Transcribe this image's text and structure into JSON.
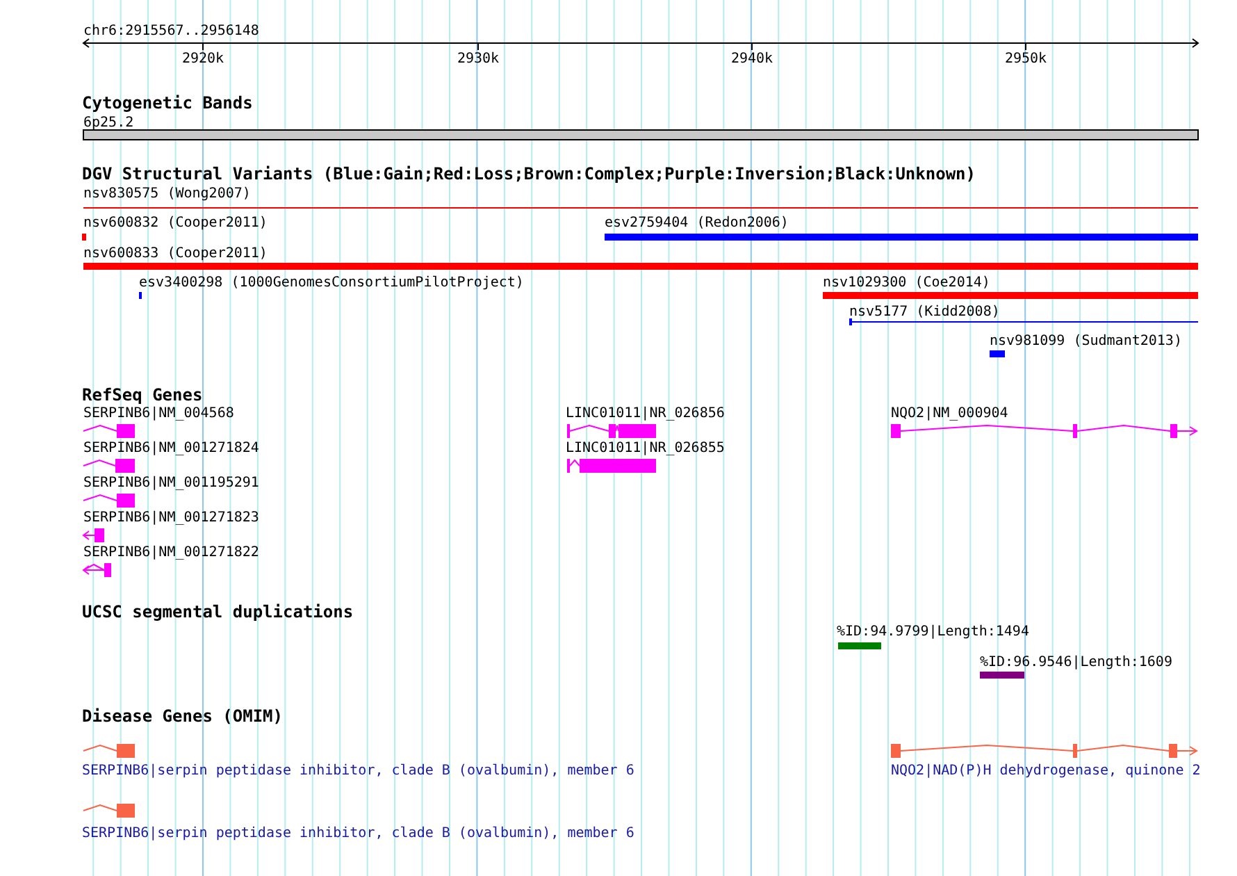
{
  "ruler": {
    "region": "chr6:2915567..2956148",
    "ticks": [
      "2920k",
      "2930k",
      "2940k",
      "2950k"
    ]
  },
  "tracks": [
    {
      "title": "Cytogenetic Bands",
      "kind": "bands",
      "features": [
        {
          "label": "6p25.2"
        }
      ]
    },
    {
      "title": "DGV Structural Variants (Blue:Gain;Red:Loss;Brown:Complex;Purple:Inversion;Black:Unknown)",
      "kind": "variants",
      "features": [
        {
          "label": "nsv830575 (Wong2007)",
          "color": "#ff0000"
        },
        {
          "label": "nsv600832 (Cooper2011)",
          "color": "#ff0000"
        },
        {
          "label": "esv2759404 (Redon2006)",
          "color": "#0000ff"
        },
        {
          "label": "nsv600833 (Cooper2011)",
          "color": "#ff0000"
        },
        {
          "label": "esv3400298 (1000GenomesConsortiumPilotProject)",
          "color": "#0000ff"
        },
        {
          "label": "nsv1029300 (Coe2014)",
          "color": "#ff0000"
        },
        {
          "label": "nsv5177 (Kidd2008)",
          "color": "#0000ff"
        },
        {
          "label": "nsv981099 (Sudmant2013)",
          "color": "#0000ff"
        }
      ]
    },
    {
      "title": "RefSeq Genes",
      "kind": "genes",
      "features": [
        {
          "label": "SERPINB6|NM_004568"
        },
        {
          "label": "SERPINB6|NM_001271824"
        },
        {
          "label": "SERPINB6|NM_001195291"
        },
        {
          "label": "SERPINB6|NM_001271823"
        },
        {
          "label": "SERPINB6|NM_001271822"
        },
        {
          "label": "LINC01011|NR_026856"
        },
        {
          "label": "LINC01011|NR_026855"
        },
        {
          "label": "NQO2|NM_000904"
        }
      ]
    },
    {
      "title": "UCSC segmental duplications",
      "kind": "segdups",
      "features": [
        {
          "label": "%ID:94.9799|Length:1494",
          "color": "#008000"
        },
        {
          "label": "%ID:96.9546|Length:1609",
          "color": "#800080"
        }
      ]
    },
    {
      "title": "Disease Genes (OMIM)",
      "kind": "disease",
      "features": [
        {
          "label": "SERPINB6|serpin peptidase inhibitor, clade B (ovalbumin), member 6"
        },
        {
          "label": "NQO2|NAD(P)H dehydrogenase, quinone 2"
        },
        {
          "label": "SERPINB6|serpin peptidase inhibitor, clade B (ovalbumin), member 6"
        }
      ]
    }
  ]
}
